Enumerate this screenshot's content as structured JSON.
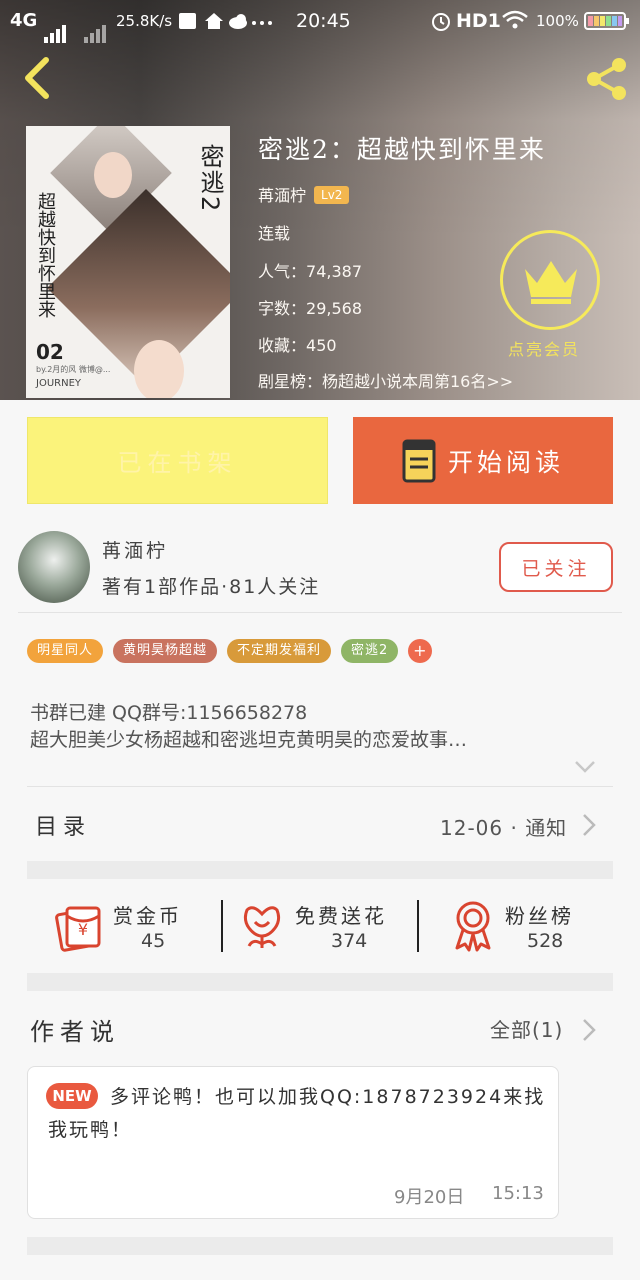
{
  "status_bar": {
    "network": "4G",
    "speed": "25.8K/s",
    "time": "20:45",
    "hd": "HD1",
    "battery": "100%"
  },
  "header": {
    "back_icon": "chevron-left-icon",
    "share_icon": "share-icon"
  },
  "book": {
    "cover": {
      "title_vertical": "密逃2",
      "subtitle_vertical": "超越快到怀里来",
      "number": "02",
      "small_text": "by.2月的风 微博@...",
      "journey": "JOURNEY"
    },
    "title": "密逃2：超越快到怀里来",
    "author": "苒湎柠",
    "level": "Lv2",
    "status": "连载",
    "popularity_label": "人气：",
    "popularity": "74,387",
    "word_count_label": "字数：",
    "word_count": "29,568",
    "favorites_label": "收藏：",
    "favorites": "450",
    "ranking": "剧星榜：杨超越小说本周第16名>>",
    "vip_label": "点亮会员"
  },
  "actions": {
    "shelf_label": "已在书架",
    "read_label": "开始阅读"
  },
  "author_card": {
    "name": "苒湎柠",
    "meta": "著有1部作品·81人关注",
    "follow_label": "已关注"
  },
  "tags": [
    {
      "label": "明星同人",
      "color": "#f2a33c"
    },
    {
      "label": "黄明昊杨超越",
      "color": "#c9735f"
    },
    {
      "label": "不定期发福利",
      "color": "#d89a3a"
    },
    {
      "label": "密逃2",
      "color": "#8fb566"
    },
    {
      "label": "+",
      "color": "#ee6a4e"
    }
  ],
  "description": {
    "line1": "书群已建 QQ群号:1156658278",
    "line2": "超大胆美少女杨超越和密逃坦克黄明昊的恋爱故事…"
  },
  "catalog": {
    "label": "目录",
    "update": "12-06 · 通知"
  },
  "stats": {
    "reward_label": "赏金币",
    "reward_value": "45",
    "flower_label": "免费送花",
    "flower_value": "374",
    "fans_label": "粉丝榜",
    "fans_value": "528"
  },
  "author_says": {
    "title": "作者说",
    "all": "全部(1)",
    "badge": "NEW",
    "text": "多评论鸭！也可以加我QQ:1878723924来找我玩鸭！",
    "date": "9月20日",
    "time": "15:13"
  }
}
